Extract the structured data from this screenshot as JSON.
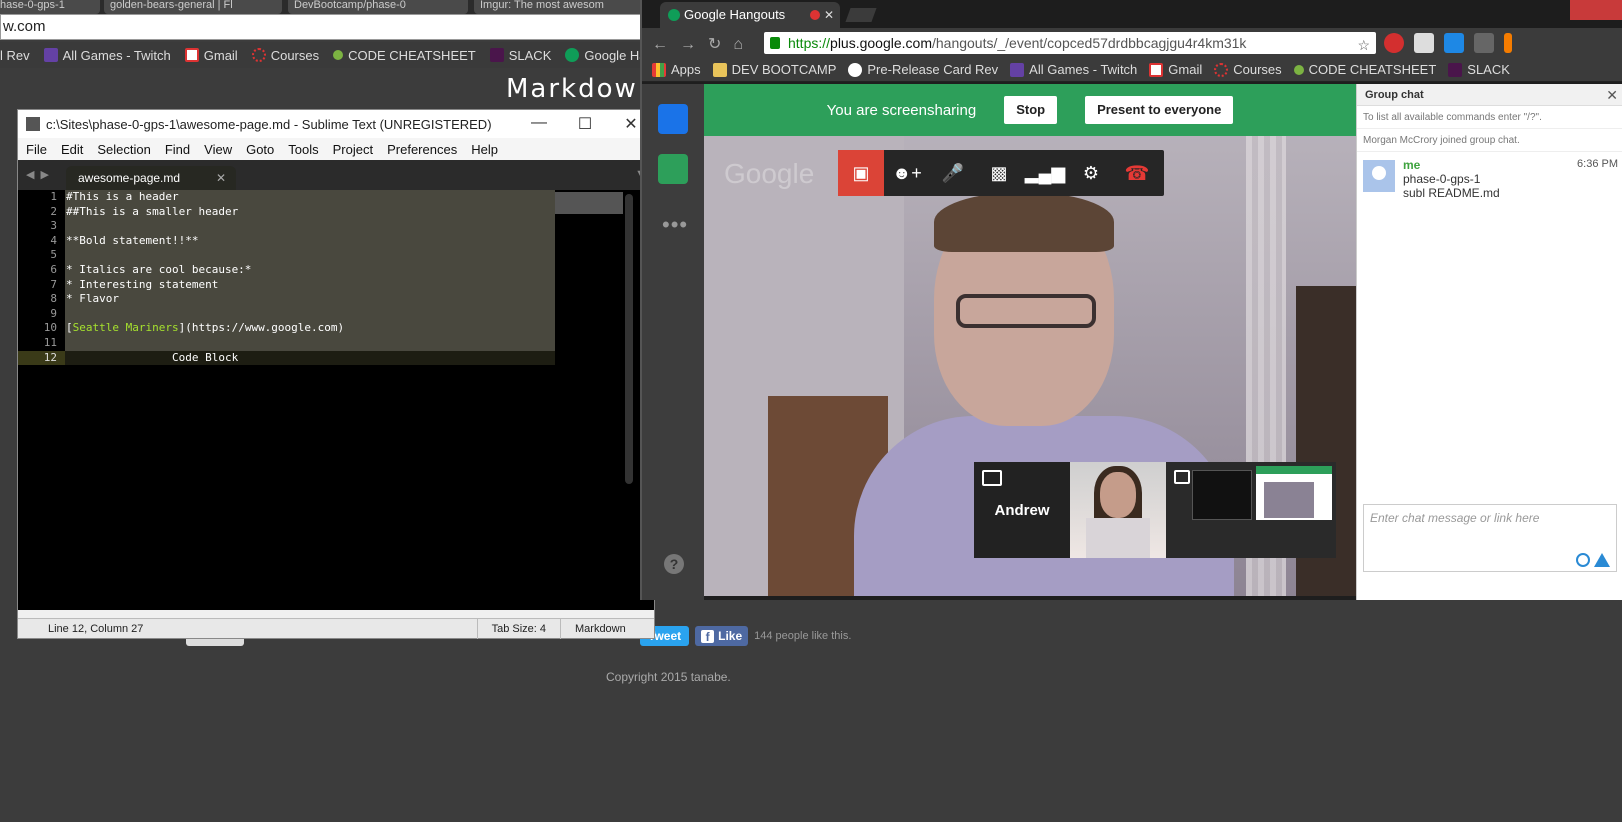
{
  "bg_browser": {
    "tabs": [
      "hase-0-gps-1",
      "golden-bears-general | Fl",
      "DevBootcamp/phase-0",
      "Imgur: The most awesom"
    ],
    "address": "w.com",
    "bookmarks": [
      {
        "label": "l Rev",
        "icon": "reddit-icon"
      },
      {
        "label": "All Games - Twitch",
        "icon": "twitch-icon"
      },
      {
        "label": "Gmail",
        "icon": "gmail-icon"
      },
      {
        "label": "Courses",
        "icon": "courses-icon"
      },
      {
        "label": "CODE CHEATSHEET",
        "icon": "green-circle-icon"
      },
      {
        "label": "SLACK",
        "icon": "slack-icon"
      },
      {
        "label": "Google Hangouts",
        "icon": "hangouts-icon"
      }
    ],
    "page_heading": "Markdown L",
    "tweet_label": "Tweet",
    "like_label": "Like",
    "like_count": "144 people like this.",
    "copyright": "Copyright 2015 tanabe."
  },
  "sublime": {
    "title": "c:\\Sites\\phase-0-gps-1\\awesome-page.md - Sublime Text (UNREGISTERED)",
    "menu": [
      "File",
      "Edit",
      "Selection",
      "Find",
      "View",
      "Goto",
      "Tools",
      "Project",
      "Preferences",
      "Help"
    ],
    "tab": "awesome-page.md",
    "lines": [
      {
        "n": "1",
        "text": "#This is a header"
      },
      {
        "n": "2",
        "text": "##This is a smaller header"
      },
      {
        "n": "3",
        "text": ""
      },
      {
        "n": "4",
        "text": "**Bold statement!!**"
      },
      {
        "n": "5",
        "text": ""
      },
      {
        "n": "6",
        "text": "* Italics are cool because:*"
      },
      {
        "n": "7",
        "text": "* Interesting statement"
      },
      {
        "n": "8",
        "text": "* Flavor"
      },
      {
        "n": "9",
        "text": ""
      },
      {
        "n": "10",
        "pre": "[",
        "link": "Seattle Mariners",
        "post": "](https://www.google.com)"
      },
      {
        "n": "11",
        "text": ""
      },
      {
        "n": "12",
        "text": "                Code Block"
      }
    ],
    "status_position": "Line 12, Column 27",
    "status_tab": "Tab Size: 4",
    "status_syntax": "Markdown"
  },
  "hangouts": {
    "tab_title": "Google Hangouts",
    "url_https": "https://",
    "url_host": "plus.google.com",
    "url_path": "/hangouts/_/event/copced57drdbbcagjgu4r4km31k",
    "bookmarks": [
      {
        "label": "Apps",
        "icon": "apps-grid-icon"
      },
      {
        "label": "DEV BOOTCAMP",
        "icon": "folder-icon"
      },
      {
        "label": "Pre-Release Card Rev",
        "icon": "reddit-icon"
      },
      {
        "label": "All Games - Twitch",
        "icon": "twitch-icon"
      },
      {
        "label": "Gmail",
        "icon": "gmail-icon"
      },
      {
        "label": "Courses",
        "icon": "courses-icon"
      },
      {
        "label": "CODE CHEATSHEET",
        "icon": "green-circle-icon"
      },
      {
        "label": "SLACK",
        "icon": "slack-icon"
      }
    ],
    "screenshare_text": "You are screensharing",
    "stop_label": "Stop",
    "present_label": "Present to everyone",
    "watermark": "Google",
    "participant_name": "Andrew",
    "chat": {
      "header": "Group chat",
      "system_messages": [
        "To list all available commands enter \"/?\".",
        "Morgan McCrory joined group chat."
      ],
      "message_name": "me",
      "message_time": "6:36 PM",
      "message_lines": [
        "phase-0-gps-1",
        "subl README.md"
      ],
      "input_placeholder": "Enter chat message or link here"
    }
  },
  "colors": {
    "hangouts_green": "#2d9f5a",
    "active_red": "#db4437",
    "link_green": "#a6e22e"
  }
}
